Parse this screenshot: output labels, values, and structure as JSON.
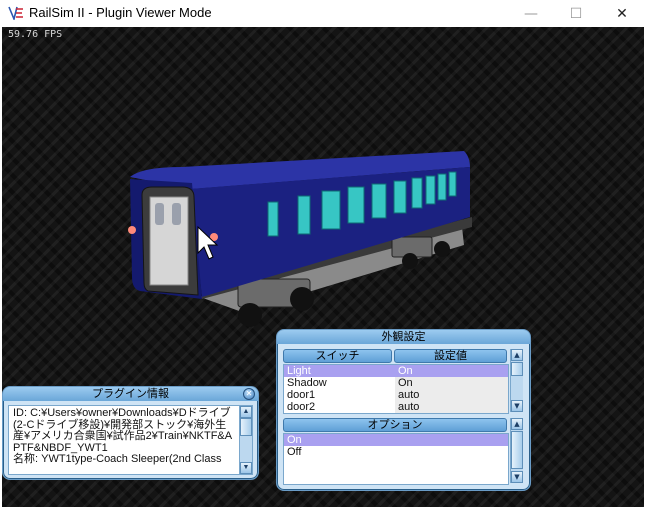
{
  "window": {
    "title": "RailSim II - Plugin Viewer Mode",
    "minimize_glyph": "—",
    "maximize_glyph": "☐",
    "close_glyph": "✕"
  },
  "viewport": {
    "fps": "59.76 FPS"
  },
  "plugin_info_panel": {
    "title": "プラグイン情報",
    "text": "ID: C:¥Users¥owner¥Downloads¥Dドライブ(2-Cドライブ移設)¥開発部ストック¥海外生産¥アメリカ合衆国¥試作品2¥Train¥NKTF&APTF&NBDF_YWT1\n名称: YWT1type-Coach Sleeper(2nd Class"
  },
  "appearance_panel": {
    "title": "外観設定",
    "switch_header": "スイッチ",
    "value_header": "設定値",
    "switches": [
      {
        "name": "Light",
        "value": "On",
        "selected": true
      },
      {
        "name": "Shadow",
        "value": "On",
        "selected": false
      },
      {
        "name": "door1",
        "value": "auto",
        "selected": false
      },
      {
        "name": "door2",
        "value": "auto",
        "selected": false
      }
    ],
    "options_header": "オプション",
    "options": [
      {
        "label": "On",
        "selected": true
      },
      {
        "label": "Off",
        "selected": false
      }
    ]
  },
  "colors": {
    "car_body": "#141a6e",
    "window_glass": "#37c6c4",
    "panel_bg": "#cfe4f5",
    "selection": "#a9a0f0"
  }
}
